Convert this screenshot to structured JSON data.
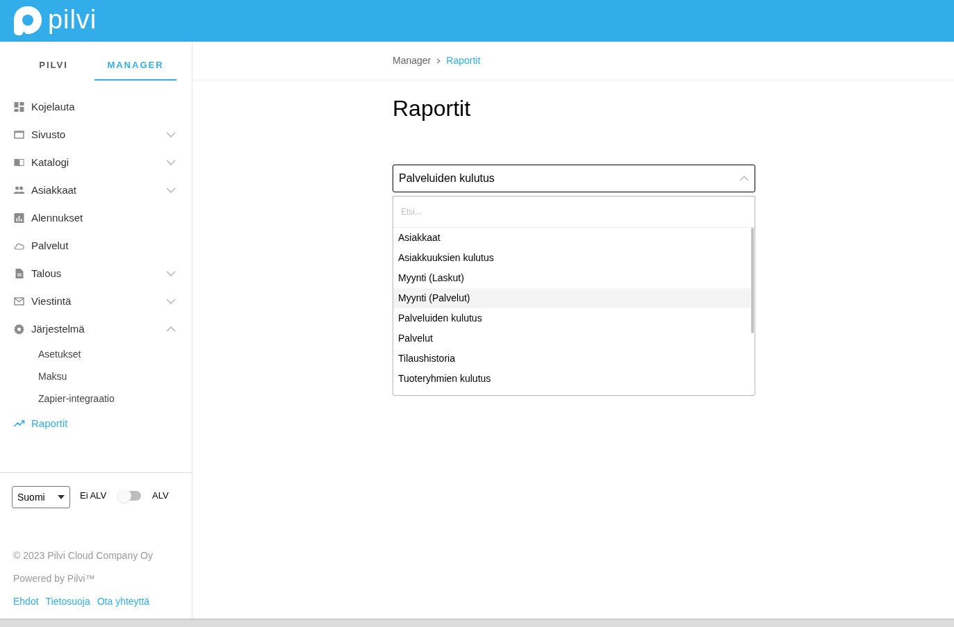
{
  "header": {
    "logo_text": "pilvi"
  },
  "sidebar": {
    "tabs": [
      {
        "label": "PILVI",
        "selected": false
      },
      {
        "label": "MANAGER",
        "selected": true
      }
    ],
    "items": [
      {
        "label": "Kojelauta",
        "selected": false
      },
      {
        "label": "Sivusto",
        "selected": false,
        "expanded": false
      },
      {
        "label": "Katalogi",
        "selected": false,
        "expanded": false
      },
      {
        "label": "Asiakkaat",
        "selected": false,
        "expanded": false
      },
      {
        "label": "Alennukset",
        "selected": false
      },
      {
        "label": "Palvelut",
        "selected": false
      },
      {
        "label": "Talous",
        "selected": false,
        "expanded": false
      },
      {
        "label": "Viestintä",
        "selected": false,
        "expanded": false
      },
      {
        "label": "Järjestelmä",
        "selected": false,
        "expanded": true,
        "children": [
          {
            "label": "Asetukset",
            "selected": false
          },
          {
            "label": "Maksu",
            "selected": false
          },
          {
            "label": "Zapier-integraatio",
            "selected": false
          }
        ]
      },
      {
        "label": "Raportit",
        "selected": true
      }
    ],
    "language": {
      "value": "Suomi"
    },
    "vat_toggle": {
      "off_label": "Ei ALV",
      "on_label": "ALV",
      "on": false
    },
    "copyright": "© 2023 Pilvi Cloud Company Oy",
    "powered_by": "Powered by Pilvi™",
    "links": [
      "Ehdot",
      "Tietosuoja",
      "Ota yhteyttä"
    ]
  },
  "breadcrumb": [
    "Manager",
    "Raportit"
  ],
  "page_title": "Raportit",
  "report_select": {
    "value": "Palveluiden kulutus",
    "expanded": true,
    "search_placeholder": "Etsi...",
    "options": [
      {
        "label": "Asiakkaat",
        "highlighted": false
      },
      {
        "label": "Asiakkuuksien kulutus",
        "highlighted": false
      },
      {
        "label": "Myynti (Laskut)",
        "highlighted": false
      },
      {
        "label": "Myynti (Palvelut)",
        "highlighted": true
      },
      {
        "label": "Palveluiden kulutus",
        "highlighted": false
      },
      {
        "label": "Palvelut",
        "highlighted": false
      },
      {
        "label": "Tilaushistoria",
        "highlighted": false
      },
      {
        "label": "Tuoteryhmien kulutus",
        "highlighted": false
      }
    ]
  }
}
